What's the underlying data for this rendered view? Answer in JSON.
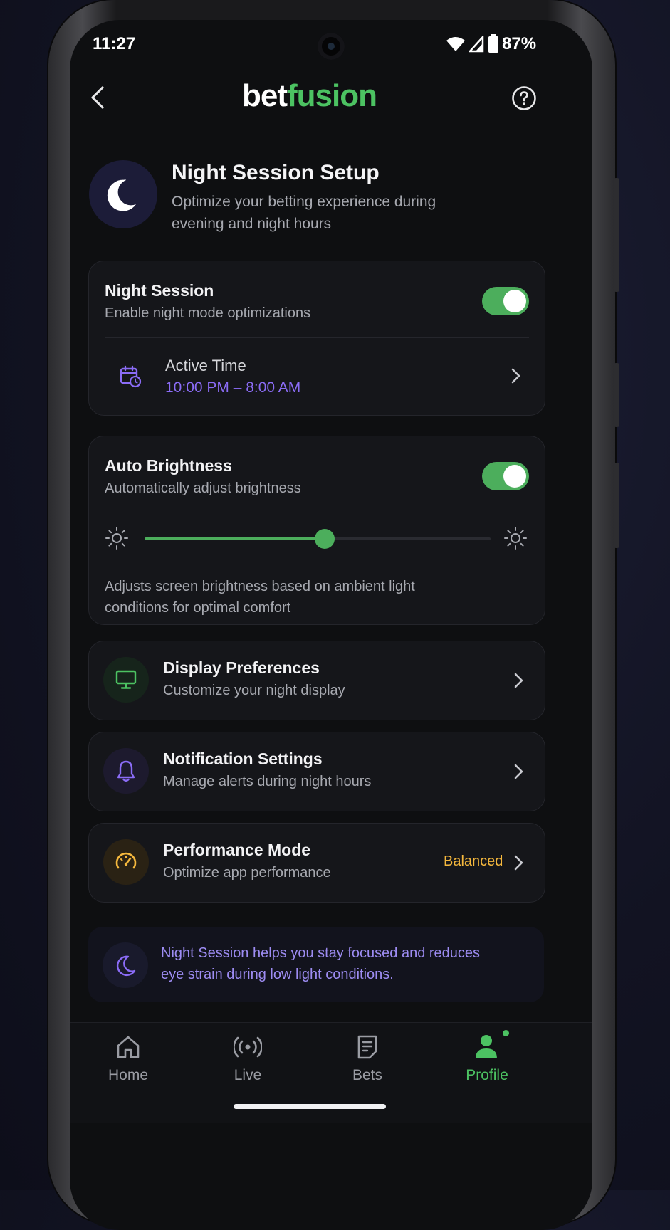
{
  "status_bar": {
    "time": "11:27",
    "battery": "87%"
  },
  "header": {
    "brand_part1": "bet",
    "brand_part2": "fusion"
  },
  "hero": {
    "title": "Night Session Setup",
    "subtitle_line1": "Optimize your betting experience during",
    "subtitle_line2": "evening and night hours"
  },
  "night_session": {
    "title": "Night Session",
    "subtitle": "Enable night mode optimizations",
    "enabled": true,
    "active_time_label": "Active Time",
    "active_time_value": "10:00 PM – 8:00 AM"
  },
  "auto_brightness": {
    "title": "Auto Brightness",
    "subtitle": "Automatically adjust brightness",
    "enabled": true,
    "slider_level": 0.52,
    "description_line1": "Adjusts screen brightness based on ambient light",
    "description_line2": "conditions for optimal comfort"
  },
  "menu": [
    {
      "title": "Display Preferences",
      "subtitle": "Customize your night display",
      "icon": "monitor-icon"
    },
    {
      "title": "Notification Settings",
      "subtitle": "Manage alerts during night hours",
      "icon": "bell-icon"
    },
    {
      "title": "Performance Mode",
      "subtitle": "Optimize app performance",
      "icon": "speedometer-icon",
      "value": "Balanced"
    }
  ],
  "info": {
    "line1": "Night Session helps you stay focused and reduces",
    "line2": "eye strain during low light conditions."
  },
  "bottom_nav": [
    {
      "label": "Home",
      "icon": "home-icon",
      "active": false
    },
    {
      "label": "Live",
      "icon": "broadcast-icon",
      "active": false
    },
    {
      "label": "Bets",
      "icon": "bet-slip-icon",
      "active": false
    },
    {
      "label": "Profile",
      "icon": "profile-icon",
      "active": true
    }
  ],
  "colors": {
    "accent_green": "#4cc262",
    "accent_purple": "#8b6cf6",
    "accent_amber": "#f5b83d",
    "background": "#0e0f11",
    "card": "#15161a"
  }
}
